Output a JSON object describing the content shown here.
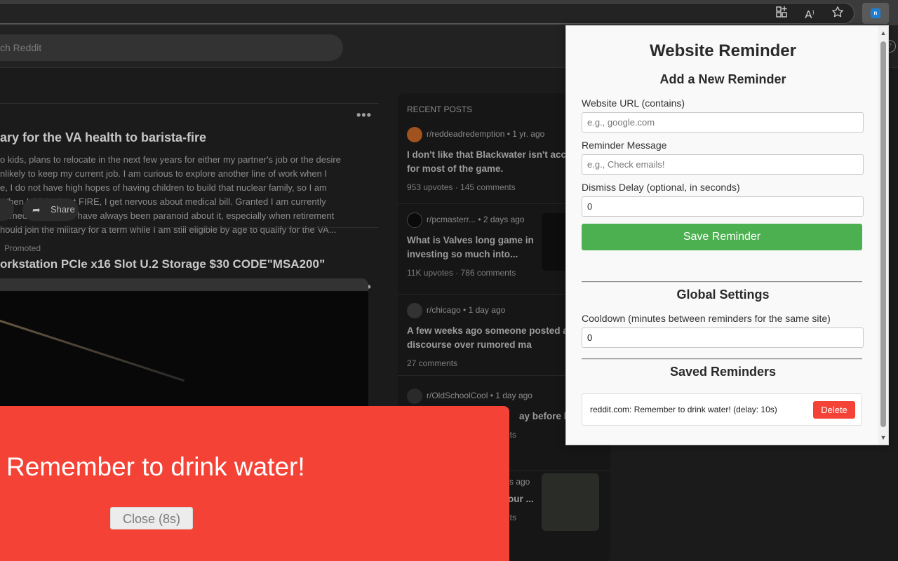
{
  "toolbar": {
    "icons": [
      "apps-icon",
      "read-aloud-icon",
      "favorite-star-icon",
      "extension-icon"
    ],
    "read_aloud_glyph": "A",
    "ext_logo": "n"
  },
  "reddit": {
    "search_placeholder": "ch Reddit",
    "post": {
      "title": "ary for the VA health to barista-fire",
      "body": "o kids, plans to relocate in the next few years for either my partner's job or the desire\nnlikely to keep my current job. I am curious to explore another line of work when I\ne, I do not have high hopes of having children to build that nuclear family, so I am\nWhen I think about FIRE, I get nervous about medical bill. Granted I am currently\nle medical bill but I have always been paranoid about it, especially when retirement\nhould join the military for a term while I am still eligible by age to qualify for the VA...",
      "share_label": "Share",
      "more": "•••"
    },
    "promoted": {
      "label": "Promoted",
      "title": "orkstation PCIe x16 Slot U.2 Storage $30 CODE\"MSA200”",
      "more": "•••"
    },
    "recent": {
      "heading": "RECENT POSTS",
      "items": [
        {
          "sub": "r/reddeadredemption",
          "time": "1 yr. ago",
          "title": "I don't like that Blackwater isn't accessible for most of the game.",
          "stats": "953 upvotes · 145 comments"
        },
        {
          "sub": "r/pcmasterr...",
          "time": "2 days ago",
          "title": "What is Valves long game in investing so much into...",
          "stats": "11K upvotes · 786 comments"
        },
        {
          "sub": "r/chicago",
          "time": "1 day ago",
          "title": "A few weeks ago someone posted a started discourse over rumored ma",
          "stats": "27 comments"
        },
        {
          "sub": "r/OldSchoolCool",
          "time": "1 day ago",
          "title": "ay before his",
          "stats": "nts"
        },
        {
          "sub": "",
          "time": "ys ago",
          "title": "our ...",
          "stats": "nts"
        }
      ]
    }
  },
  "reminder_overlay": {
    "message": "Remember to drink water!",
    "close_label": "Close (8s)",
    "color": "#f44336"
  },
  "popup": {
    "title": "Website Reminder",
    "add_heading": "Add a New Reminder",
    "url_label": "Website URL (contains)",
    "url_placeholder": "e.g., google.com",
    "message_label": "Reminder Message",
    "message_placeholder": "e.g., Check emails!",
    "delay_label": "Dismiss Delay (optional, in seconds)",
    "delay_value": "0",
    "save_label": "Save Reminder",
    "save_color": "#4caf50",
    "global_heading": "Global Settings",
    "cooldown_label": "Cooldown (minutes between reminders for the same site)",
    "cooldown_value": "0",
    "saved_heading": "Saved Reminders",
    "saved_items": [
      {
        "text": "reddit.com: Remember to drink water! (delay: 10s)",
        "delete_label": "Delete"
      }
    ]
  }
}
